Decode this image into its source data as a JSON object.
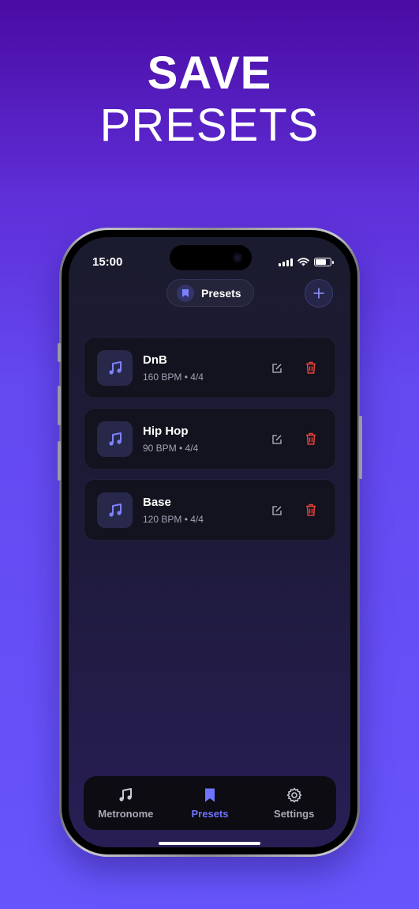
{
  "headline": {
    "line1": "SAVE",
    "line2": "PRESETS"
  },
  "status_bar": {
    "time": "15:00"
  },
  "nav": {
    "title": "Presets",
    "title_icon": "bookmark-icon",
    "add_icon": "plus-icon"
  },
  "presets": [
    {
      "name": "DnB",
      "meta": "160 BPM • 4/4"
    },
    {
      "name": "Hip Hop",
      "meta": "90 BPM • 4/4"
    },
    {
      "name": "Base",
      "meta": "120 BPM • 4/4"
    }
  ],
  "tabs": [
    {
      "label": "Metronome",
      "icon": "music-note-icon",
      "active": false
    },
    {
      "label": "Presets",
      "icon": "bookmark-icon",
      "active": true
    },
    {
      "label": "Settings",
      "icon": "gear-icon",
      "active": false
    }
  ],
  "colors": {
    "accent": "#6f74ff",
    "delete": "#e8413a",
    "background_top": "#4a0ba3",
    "background_bottom": "#6755fb"
  }
}
